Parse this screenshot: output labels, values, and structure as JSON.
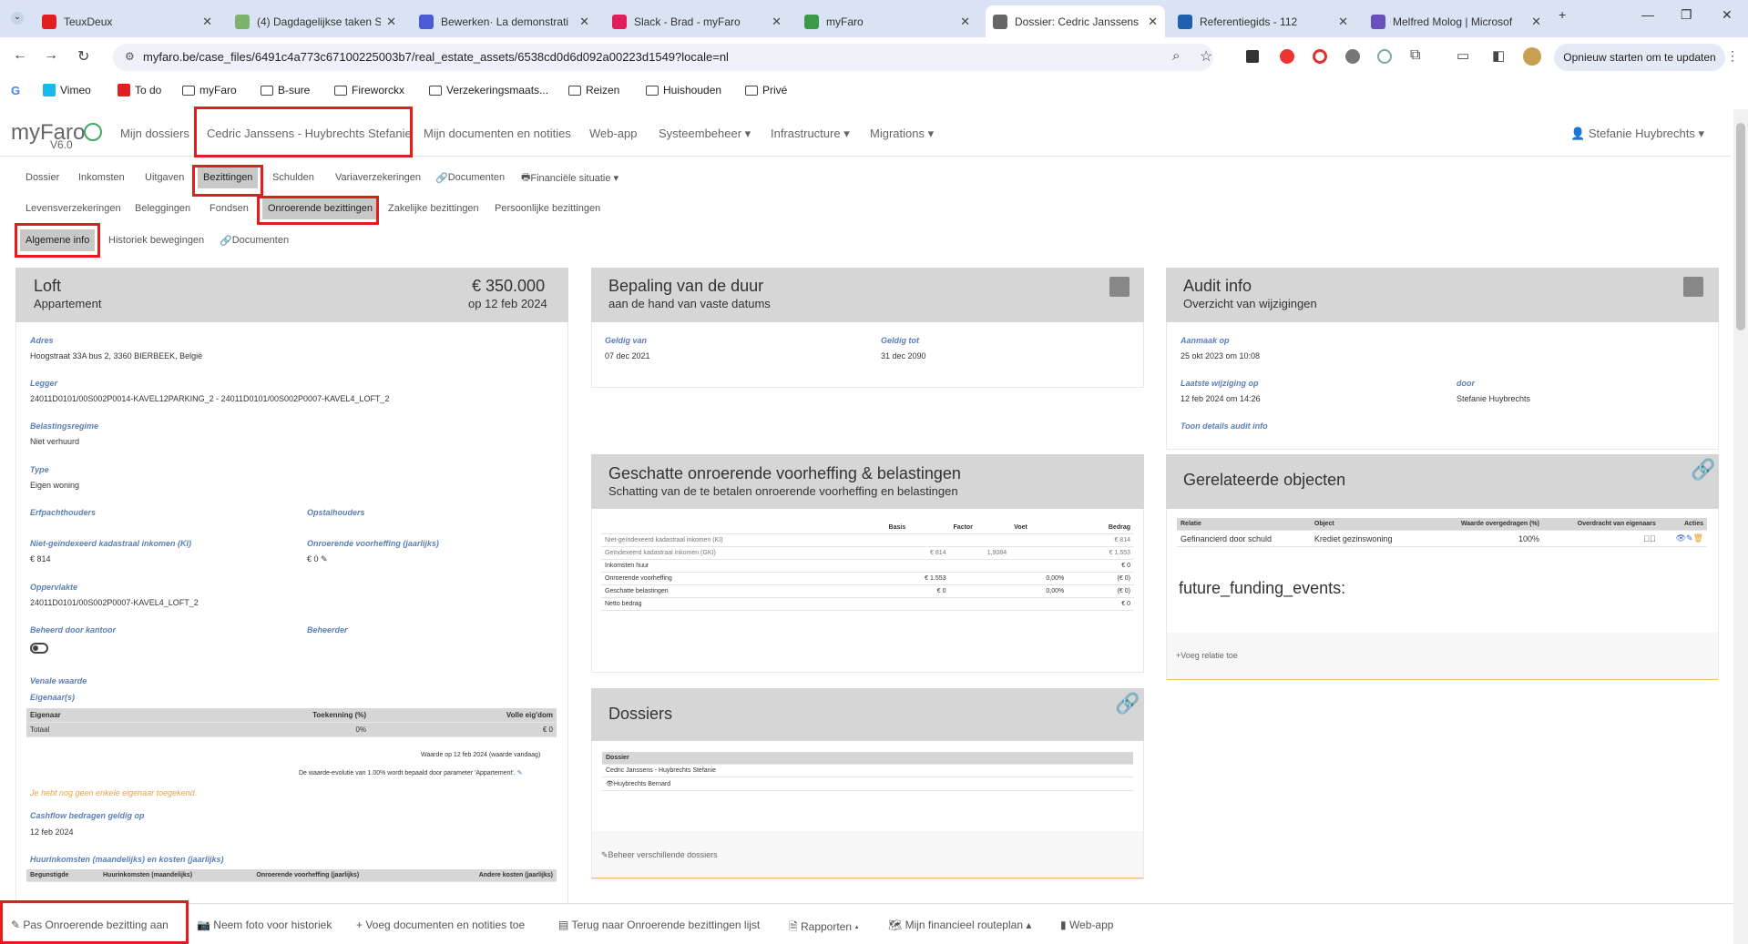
{
  "browser": {
    "tabs": [
      {
        "title": "TeuxDeux",
        "color": "#e02020"
      },
      {
        "title": "(4) Dagdagelijkse taken S",
        "color": "#7bb36b"
      },
      {
        "title": "Bewerken· La demonstrati",
        "color": "#4a5cd1"
      },
      {
        "title": "Slack - Brad - myFaro",
        "color": "#e01e5a"
      },
      {
        "title": "myFaro",
        "color": "#3a9a4a"
      },
      {
        "title": "Dossier: Cedric Janssens",
        "color": "#666"
      },
      {
        "title": "Referentiegids - 112",
        "color": "#2060b0"
      },
      {
        "title": "Melfred Molog | Microsof",
        "color": "#6b4fbb"
      }
    ],
    "url": "myfaro.be/case_files/6491c4a773c67100225003b7/real_estate_assets/6538cd0d6d092a00223d1549?locale=nl",
    "update_button": "Opnieuw starten om te updaten",
    "bookmarks": [
      "Vimeo",
      "To do",
      "myFaro",
      "B-sure",
      "Fireworckx",
      "Verzekeringsmaats...",
      "Reizen",
      "Huishouden",
      "Privé"
    ]
  },
  "app": {
    "brand": "myFaro",
    "version": "V6.0",
    "nav": [
      "Mijn dossiers",
      "Cedric Janssens - Huybrechts Stefanie",
      "Mijn documenten en notities",
      "Web-app",
      "Systeembeheer ▾",
      "Infrastructure ▾",
      "Migrations ▾"
    ],
    "user": "Stefanie Huybrechts ▾",
    "tabs1": [
      "Dossier",
      "Inkomsten",
      "Uitgaven",
      "Bezittingen",
      "Schulden",
      "Variaverzekeringen",
      "Documenten",
      "Financiële situatie ▾"
    ],
    "tabs2": [
      "Levensverzekeringen",
      "Beleggingen",
      "Fondsen",
      "Onroerende bezittingen",
      "Zakelijke bezittingen",
      "Persoonlijke bezittingen"
    ],
    "tabs3": [
      "Algemene info",
      "Historiek bewegingen",
      "Documenten"
    ]
  },
  "loft": {
    "title": "Loft",
    "subtitle": "Appartement",
    "price": "€ 350.000",
    "price_date": "op 12 feb 2024",
    "adres_label": "Adres",
    "adres": "Hoogstraat 33A bus 2, 3360 BIERBEEK, België",
    "legger_label": "Legger",
    "legger": "24011D0101/00S002P0014-KAVEL12PARKING_2 - 24011D0101/00S002P0007-KAVEL4_LOFT_2",
    "regime_label": "Belastingsregime",
    "regime": "Niet verhuurd",
    "type_label": "Type",
    "type": "Eigen woning",
    "erfpacht_label": "Erfpachthouders",
    "opstal_label": "Opstalhouders",
    "ki_label": "Niet-geïndexeerd kadastraal inkomen (KI)",
    "ki": "€ 814",
    "voorheffing_label": "Onroerende voorheffing (jaarlijks)",
    "voorheffing": "€ 0",
    "opp_label": "Oppervlakte",
    "opp": "24011D0101/00S002P0007-KAVEL4_LOFT_2",
    "kantoor_label": "Beheerd door kantoor",
    "beheerder_label": "Beheerder",
    "venale_label": "Venale waarde",
    "eigenaars_label": "Eigenaar(s)",
    "owners_head": [
      "Eigenaar",
      "Toekenning (%)",
      "Volle eig'dom"
    ],
    "owners_total": [
      "Totaal",
      "0%",
      "€ 0"
    ],
    "note1": "Waarde op 12 feb 2024 (waarde vandaag)",
    "note2": "De waarde-evolutie van 1.00% wordt bepaald door parameter 'Appartement'.",
    "warning": "Je hebt nog geen enkele eigenaar toegekend.",
    "cashflow_label": "Cashflow bedragen geldig op",
    "cashflow": "12 feb 2024",
    "huur_label": "Huurinkomsten (maandelijks) en kosten (jaarlijks)",
    "huur_head": [
      "Begunstigde",
      "Huurinkomsten (maandelijks)",
      "Onroerende voorheffing (jaarlijks)",
      "Andere kosten (jaarlijks)"
    ]
  },
  "duur": {
    "title": "Bepaling van de duur",
    "subtitle": "aan de hand van vaste datums",
    "van_label": "Geldig van",
    "van": "07 dec 2021",
    "tot_label": "Geldig tot",
    "tot": "31 dec 2090"
  },
  "audit": {
    "title": "Audit info",
    "subtitle": "Overzicht van wijzigingen",
    "aanmaak_label": "Aanmaak op",
    "aanmaak": "25 okt 2023 om 10:08",
    "wijz_label": "Laatste wijziging op",
    "wijz": "12 feb 2024 om 14:26",
    "door_label": "door",
    "door": "Stefanie Huybrechts",
    "details": "Toon details audit info"
  },
  "tax": {
    "title": "Geschatte onroerende voorheffing & belastingen",
    "subtitle": "Schatting van de te betalen onroerende voorheffing en belastingen",
    "head": [
      "",
      "Basis",
      "Factor",
      "Voet",
      "Bedrag"
    ],
    "rows": [
      [
        "Niet-geïndexeerd kadastraal inkomen (KI)",
        "",
        "",
        "",
        "€ 814"
      ],
      [
        "Geïndexeerd kadastraal inkomen (GKI)",
        "€ 814",
        "1,9084",
        "",
        "€ 1.553"
      ],
      [
        "Inkomsten huur",
        "",
        "",
        "",
        "€ 0"
      ],
      [
        "Onroerende voorheffing",
        "€ 1.553",
        "",
        "0,00%",
        "(€ 0)"
      ],
      [
        "Geschatte belastingen",
        "€ 0",
        "",
        "0,00%",
        "(€ 0)"
      ],
      [
        "Netto bedrag",
        "",
        "",
        "",
        "€ 0"
      ]
    ]
  },
  "related": {
    "title": "Gerelateerde objecten",
    "head": [
      "Relatie",
      "Object",
      "Waarde overgedragen (%)",
      "Overdracht van eigenaars",
      "Acties"
    ],
    "row": [
      "Gefinancierd door schuld",
      "Krediet gezinswoning",
      "100%"
    ],
    "future": "future_funding_events:",
    "add": "Voeg relatie toe"
  },
  "dossiers": {
    "title": "Dossiers",
    "head": "Dossier",
    "rows": [
      "Cedric Janssens - Huybrechts Stefanie",
      "Huybrechts Bernard"
    ],
    "manage": "Beheer verschillende dossiers"
  },
  "footer": [
    "Pas Onroerende bezitting aan",
    "Neem foto voor historiek",
    "Voeg documenten en notities toe",
    "Terug naar Onroerende bezittingen lijst",
    "Rapporten ▴",
    "Mijn financieel routeplan ▴",
    "Web-app"
  ]
}
